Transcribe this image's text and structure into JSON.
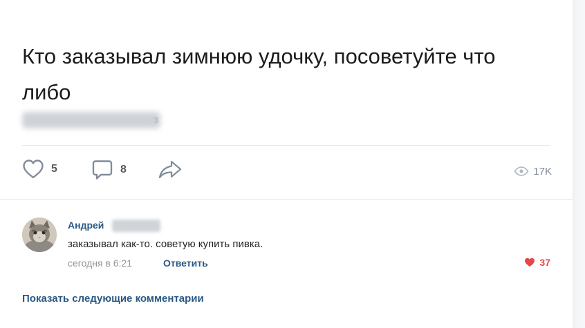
{
  "post": {
    "text": "Кто заказывал зимнюю удочку, посоветуйте что либо",
    "blurred_tail": "з"
  },
  "actions": {
    "likes": "5",
    "comments": "8",
    "views": "17K"
  },
  "comment": {
    "author": "Андрей",
    "text": "заказывал как-то. советую купить пивка.",
    "time": "сегодня в 6:21",
    "reply_label": "Ответить",
    "likes": "37"
  },
  "more_comments_label": "Показать следующие комментарии",
  "colors": {
    "link": "#2a5885",
    "heart_active": "#e64646",
    "icon_gray": "#818c99"
  }
}
